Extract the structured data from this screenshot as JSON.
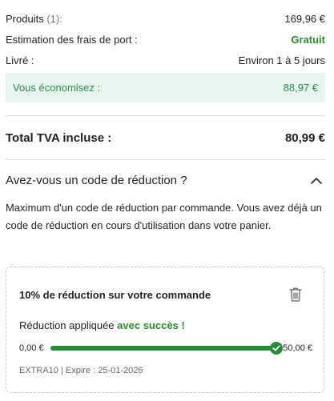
{
  "summary": {
    "products_label": "Produits",
    "products_count": "(1):",
    "products_value": "169,96 €",
    "shipping_label": "Estimation des frais de port :",
    "shipping_value": "Gratuit",
    "delivery_label": "Livré :",
    "delivery_value": "Environ 1 à 5 jours",
    "savings_label": "Vous économisez :",
    "savings_value": "88,97 €"
  },
  "total": {
    "label": "Total TVA incluse :",
    "value": "80,99 €"
  },
  "promo": {
    "header": "Avez-vous un code de réduction ?",
    "toggle_icon": "chevron-up-icon",
    "description": "Maximum d'un code de réduction par commande. Vous avez déjà un code de réduction en cours d'utilisation dans votre panier."
  },
  "coupon": {
    "title": "10% de réduction sur votre commande",
    "delete_icon": "trash-icon",
    "applied_prefix": "Réduction appliquée ",
    "applied_success": "avec succès !",
    "min_label": "0,00 €",
    "max_label": "50,00 €",
    "progress_fraction": 1.0,
    "meta": "EXTRA10 | Expire : 25-01-2026"
  },
  "colors": {
    "accent_green": "#2a8a3a",
    "savings_bg": "#e8f5ee",
    "savings_text": "#2f8a53"
  }
}
